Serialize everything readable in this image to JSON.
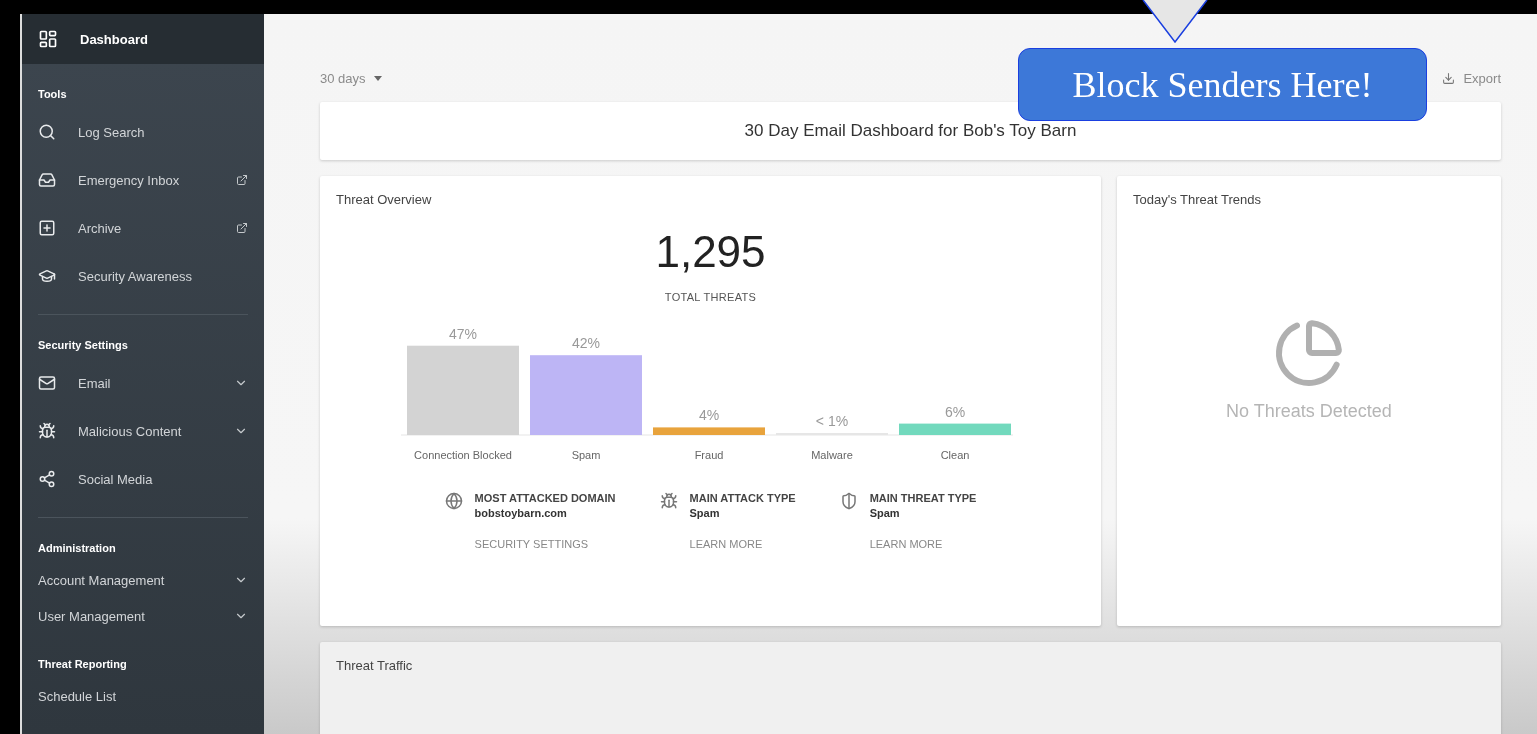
{
  "sidebar": {
    "header": {
      "label": "Dashboard"
    },
    "sections": [
      {
        "title": "Tools",
        "items": [
          {
            "label": "Log Search",
            "external": false,
            "expandable": false
          },
          {
            "label": "Emergency Inbox",
            "external": true,
            "expandable": false
          },
          {
            "label": "Archive",
            "external": true,
            "expandable": false
          },
          {
            "label": "Security Awareness",
            "external": false,
            "expandable": false
          }
        ]
      },
      {
        "title": "Security Settings",
        "items": [
          {
            "label": "Email",
            "external": false,
            "expandable": true
          },
          {
            "label": "Malicious Content",
            "external": false,
            "expandable": true
          },
          {
            "label": "Social Media",
            "external": false,
            "expandable": false
          }
        ]
      },
      {
        "title": "Administration",
        "items": [
          {
            "label": "Account Management",
            "external": false,
            "expandable": true
          },
          {
            "label": "User Management",
            "external": false,
            "expandable": true
          }
        ]
      },
      {
        "title": "Threat Reporting",
        "items": [
          {
            "label": "Schedule List",
            "external": false,
            "expandable": false
          }
        ]
      }
    ]
  },
  "toolbar": {
    "period": "30 days",
    "export": "Export"
  },
  "dashboard_title": "30 Day Email Dashboard for Bob's Toy Barn",
  "threat_overview": {
    "title": "Threat Overview",
    "total": "1,295",
    "total_label": "TOTAL THREATS",
    "chart_data": {
      "type": "bar",
      "categories": [
        "Connection Blocked",
        "Spam",
        "Fraud",
        "Malware",
        "Clean"
      ],
      "colors": [
        "#d3d3d3",
        "#bdb5f5",
        "#e8a33c",
        "#e6e6e6",
        "#72d9bd"
      ],
      "values": [
        47,
        42,
        4,
        0.5,
        6
      ],
      "value_labels": [
        "47%",
        "42%",
        "4%",
        "< 1%",
        "6%"
      ]
    },
    "stats": [
      {
        "title": "MOST ATTACKED DOMAIN",
        "value": "bobstoybarn.com",
        "link": "SECURITY SETTINGS"
      },
      {
        "title": "MAIN ATTACK TYPE",
        "value": "Spam",
        "link": "LEARN MORE"
      },
      {
        "title": "MAIN THREAT TYPE",
        "value": "Spam",
        "link": "LEARN MORE"
      }
    ]
  },
  "threat_trends": {
    "title": "Today's Threat Trends",
    "empty_message": "No Threats Detected"
  },
  "threat_traffic": {
    "title": "Threat Traffic"
  },
  "callout": {
    "text": "Block Senders Here!"
  }
}
